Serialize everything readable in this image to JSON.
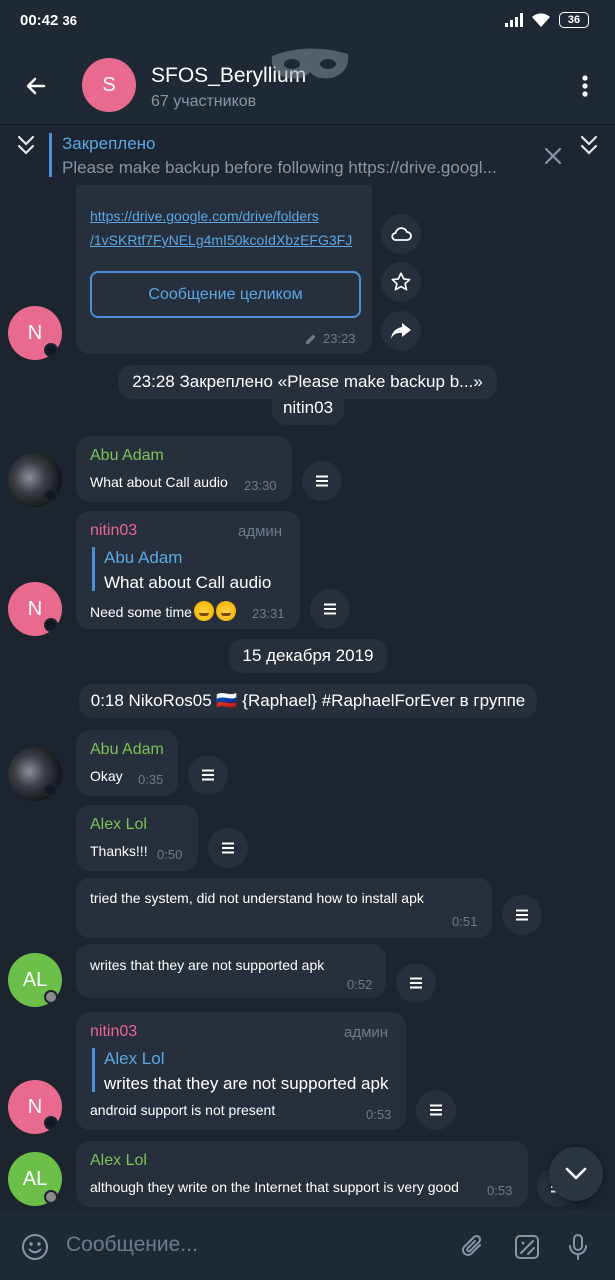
{
  "status_bar": {
    "time": "00:42",
    "time_extra": "36",
    "battery": "36"
  },
  "header": {
    "avatar_letter": "S",
    "title": "SFOS_Beryllium",
    "subtitle": "67 участников"
  },
  "pinned": {
    "title": "Закреплено",
    "text": "Please make backup before following    https://drive.googl..."
  },
  "messages": {
    "m1": {
      "link_line1": "https://drive.google.com/drive/folders",
      "link_line2": "/1vSKRtf7FyNELg4mI50kcoIdXbzEFG3FJ",
      "full_button": "Сообщение целиком",
      "time": "23:23",
      "avatar_letter": "N"
    },
    "s1": {
      "text": "23:28 Закреплено «Please make backup b...»"
    },
    "s2": {
      "text": "nitin03"
    },
    "m2": {
      "sender": "Abu Adam",
      "text": "What about Call audio",
      "time": "23:30"
    },
    "m3": {
      "sender": "nitin03",
      "badge": "админ",
      "reply_name": "Abu Adam",
      "reply_text": "What about Call audio",
      "text": "Need some time",
      "time": "23:31",
      "avatar_letter": "N"
    },
    "date1": {
      "text": "15 декабря 2019"
    },
    "s3": {
      "text": "0:18 NikoRos05 🇷🇺 {Raphael} #RaphaelForEver в группе"
    },
    "m4": {
      "sender": "Abu Adam",
      "text": "Okay",
      "time": "0:35"
    },
    "m5": {
      "sender": "Alex Lol",
      "text": "Thanks!!!",
      "time": "0:50"
    },
    "m6": {
      "text": "tried the system, did not understand how to install apk",
      "time": "0:51"
    },
    "m7": {
      "text": "writes that they are not supported apk",
      "time": "0:52",
      "avatar_letter": "AL"
    },
    "m8": {
      "sender": "nitin03",
      "badge": "админ",
      "reply_name": "Alex Lol",
      "reply_text": "writes that they are not supported apk",
      "text": "android support is not present",
      "time": "0:53",
      "avatar_letter": "N"
    },
    "m9": {
      "sender": "Alex Lol",
      "text": "although they write on the Internet that support is very good",
      "time": "0:53",
      "avatar_letter": "AL"
    }
  },
  "input": {
    "placeholder": "Сообщение..."
  },
  "colors": {
    "accent": "#4a90d9",
    "green_name": "#7fc25a",
    "pink_name": "#e8678f",
    "bubble": "#262f3b"
  }
}
